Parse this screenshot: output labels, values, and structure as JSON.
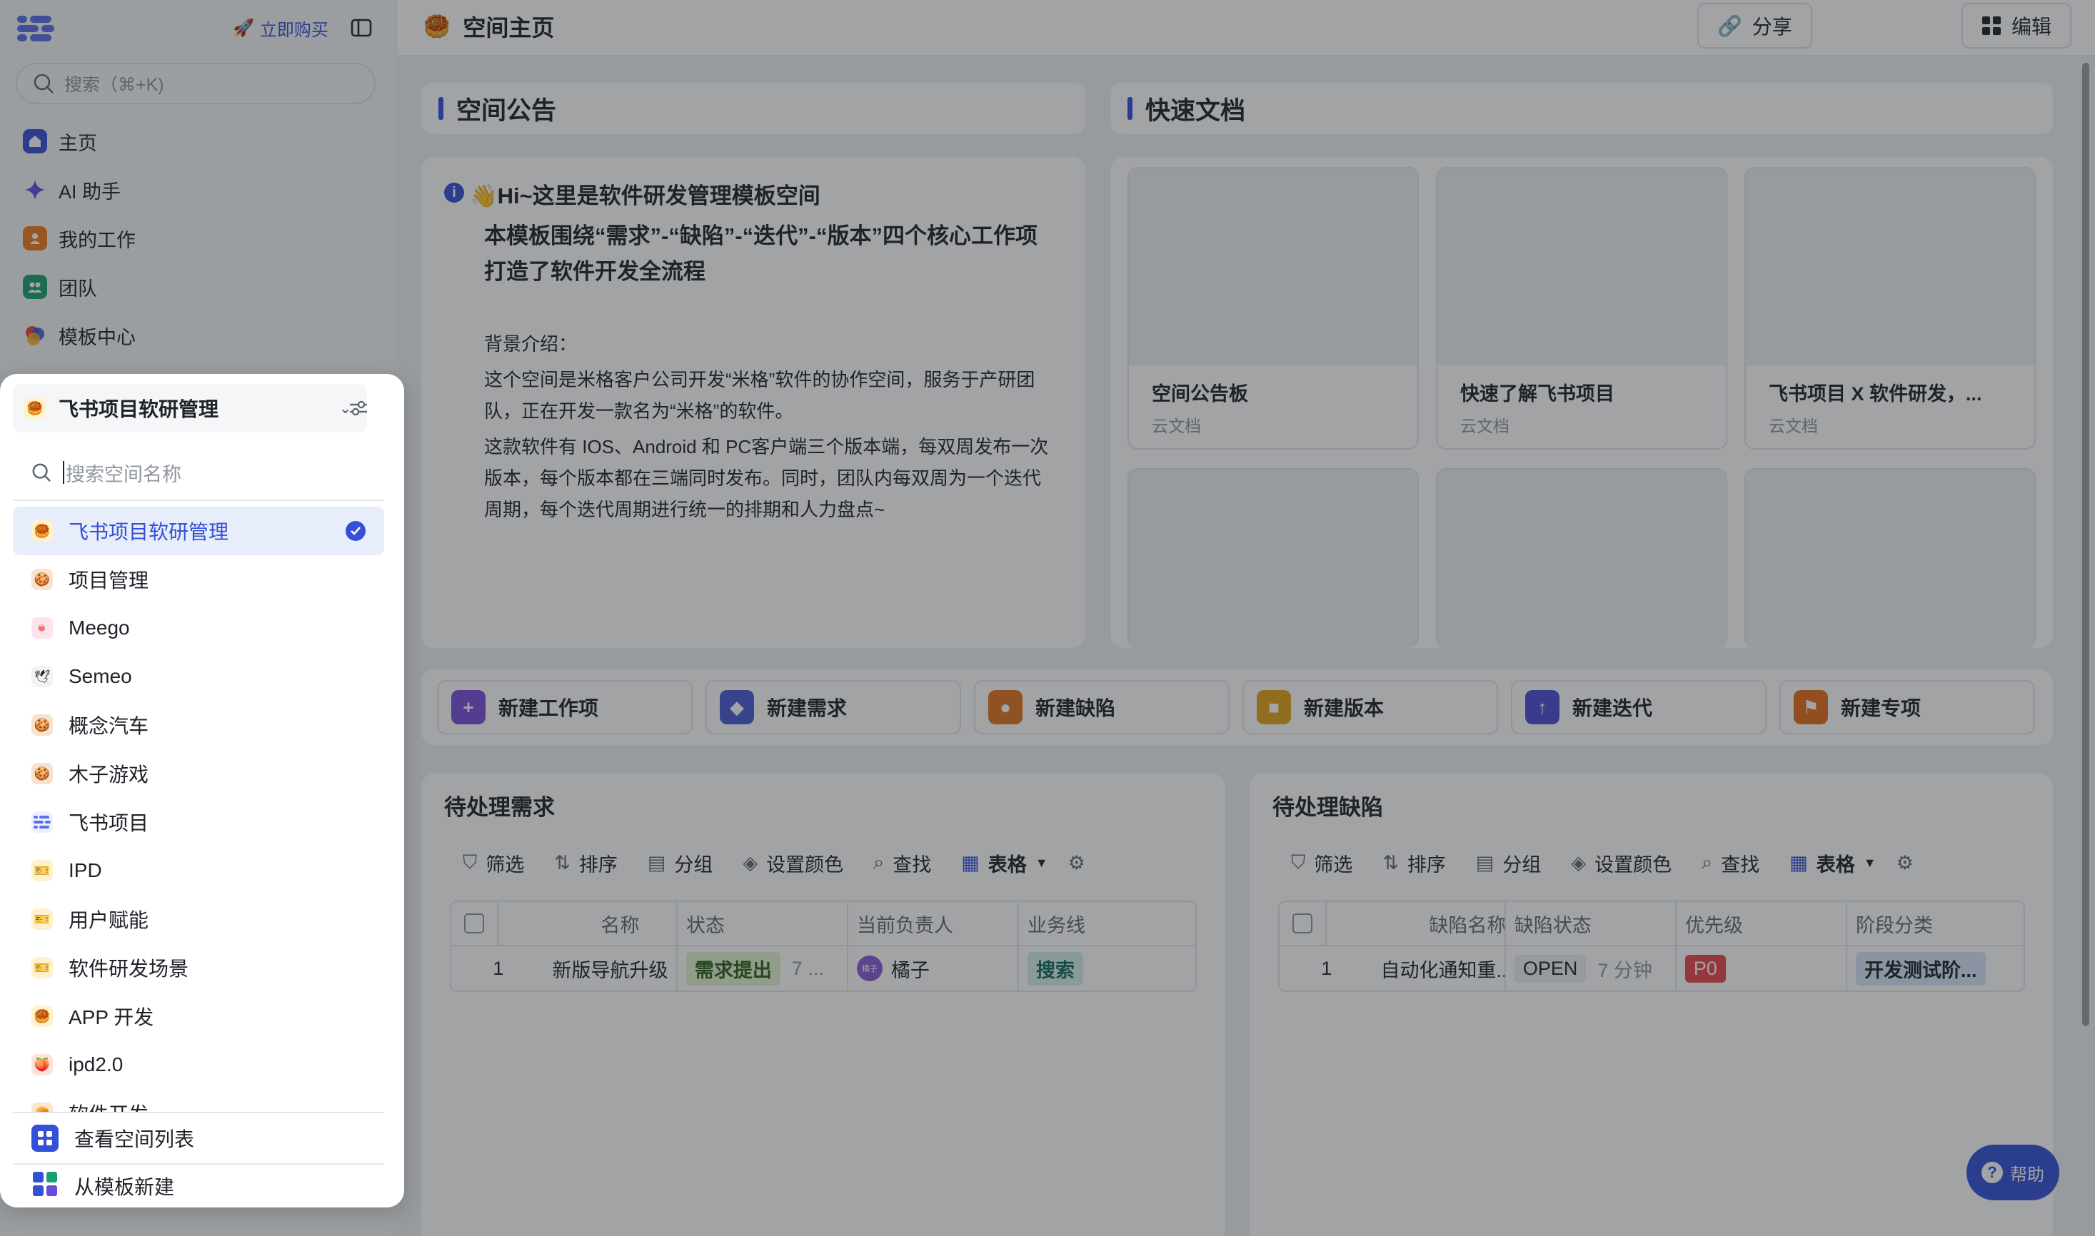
{
  "sidebar": {
    "buy_label": "立即购买",
    "search_placeholder": "搜索（⌘+K)",
    "nav": [
      {
        "label": "主页",
        "icon": "home-icon",
        "color": "#3450d6"
      },
      {
        "label": "AI 助手",
        "icon": "sparkle-icon",
        "color": "#6a4ad8"
      },
      {
        "label": "我的工作",
        "icon": "user-icon",
        "color": "#f07a1e"
      },
      {
        "label": "团队",
        "icon": "team-icon",
        "color": "#1aa06e"
      },
      {
        "label": "模板中心",
        "icon": "template-icon",
        "color": "#e8474f"
      }
    ]
  },
  "panel": {
    "current_space": "飞书项目软研管理",
    "search_placeholder": "搜索空间名称",
    "spaces": [
      {
        "label": "飞书项目软研管理",
        "icon": "space-emoji-icon",
        "bg": "#fff1c9",
        "active": true
      },
      {
        "label": "项目管理",
        "icon": "cookie-icon",
        "bg": "#f6e2cf"
      },
      {
        "label": "Meego",
        "icon": "candy-icon",
        "bg": "#fde3ea"
      },
      {
        "label": "Semeo",
        "icon": "bird-icon",
        "bg": "#f2f2f2"
      },
      {
        "label": "概念汽车",
        "icon": "cookie-icon",
        "bg": "#f6e2cf"
      },
      {
        "label": "木子游戏",
        "icon": "cookie-icon",
        "bg": "#f6e2cf"
      },
      {
        "label": "飞书项目",
        "icon": "meego-logo-icon",
        "bg": "#eef0ff"
      },
      {
        "label": "IPD",
        "icon": "ticket-icon",
        "bg": "#fff1c9"
      },
      {
        "label": "用户赋能",
        "icon": "ticket-icon",
        "bg": "#fff1c9"
      },
      {
        "label": "软件研发场景",
        "icon": "ticket-icon",
        "bg": "#fff1c9"
      },
      {
        "label": "APP 开发",
        "icon": "space-emoji-icon",
        "bg": "#fff1c9"
      },
      {
        "label": "ipd2.0",
        "icon": "peach-icon",
        "bg": "#fde3d8"
      },
      {
        "label": "软件开发",
        "icon": "bread-icon",
        "bg": "#fbe6c7"
      }
    ],
    "footer_list": "查看空间列表",
    "footer_template": "从模板新建"
  },
  "topbar": {
    "title": "空间主页",
    "share": "分享",
    "edit": "编辑"
  },
  "announcement": {
    "header": "空间公告",
    "title": "👋Hi~这里是软件研发管理模板空间",
    "bold": "本模板围绕“需求”-“缺陷”-“迭代”-“版本”四个核心工作项打造了软件开发全流程",
    "p1": "背景介绍：",
    "p2": "这个空间是米格客户公司开发“米格”软件的协作空间，服务于产研团队，正在开发一款名为“米格”的软件。",
    "p3": "这款软件有 IOS、Android 和 PC客户端三个版本端，每双周发布一次版本，每个版本都在三端同时发布。同时，团队内每双周为一个迭代周期，每个迭代周期进行统一的排期和人力盘点~"
  },
  "quickdocs": {
    "header": "快速文档",
    "docs": [
      {
        "name": "空间公告板",
        "type": "云文档"
      },
      {
        "name": "快速了解飞书项目",
        "type": "云文档"
      },
      {
        "name": "飞书项目 X 软件研发，...",
        "type": "云文档"
      }
    ]
  },
  "quick_actions": [
    {
      "label": "新建工作项",
      "color": "#7b4fd9",
      "glyph": "+"
    },
    {
      "label": "新建需求",
      "color": "#4b5bd6",
      "glyph": "◆"
    },
    {
      "label": "新建缺陷",
      "color": "#e2741e",
      "glyph": "●"
    },
    {
      "label": "新建版本",
      "color": "#e3a21a",
      "glyph": "■"
    },
    {
      "label": "新建迭代",
      "color": "#4c4fd3",
      "glyph": "↑"
    },
    {
      "label": "新建专项",
      "color": "#e36d1c",
      "glyph": "⚑"
    }
  ],
  "toolbar": {
    "filter": "筛选",
    "sort": "排序",
    "group": "分组",
    "color": "设置颜色",
    "find": "查找",
    "view": "表格"
  },
  "req_table": {
    "title": "待处理需求",
    "headers": [
      "名称",
      "状态",
      "当前负责人",
      "业务线"
    ],
    "row": {
      "index": "1",
      "name": "新版导航升级",
      "status": "需求提出",
      "status_extra": "7 ...",
      "owner": "橘子",
      "avatar": "橘子",
      "line": "搜索"
    }
  },
  "bug_table": {
    "title": "待处理缺陷",
    "headers": [
      "缺陷名称",
      "缺陷状态",
      "优先级",
      "阶段分类"
    ],
    "row": {
      "index": "1",
      "name": "自动化通知重...",
      "status": "OPEN",
      "status_extra": "7 分钟",
      "priority": "P0",
      "stage": "开发测试阶..."
    }
  },
  "help": "帮助"
}
